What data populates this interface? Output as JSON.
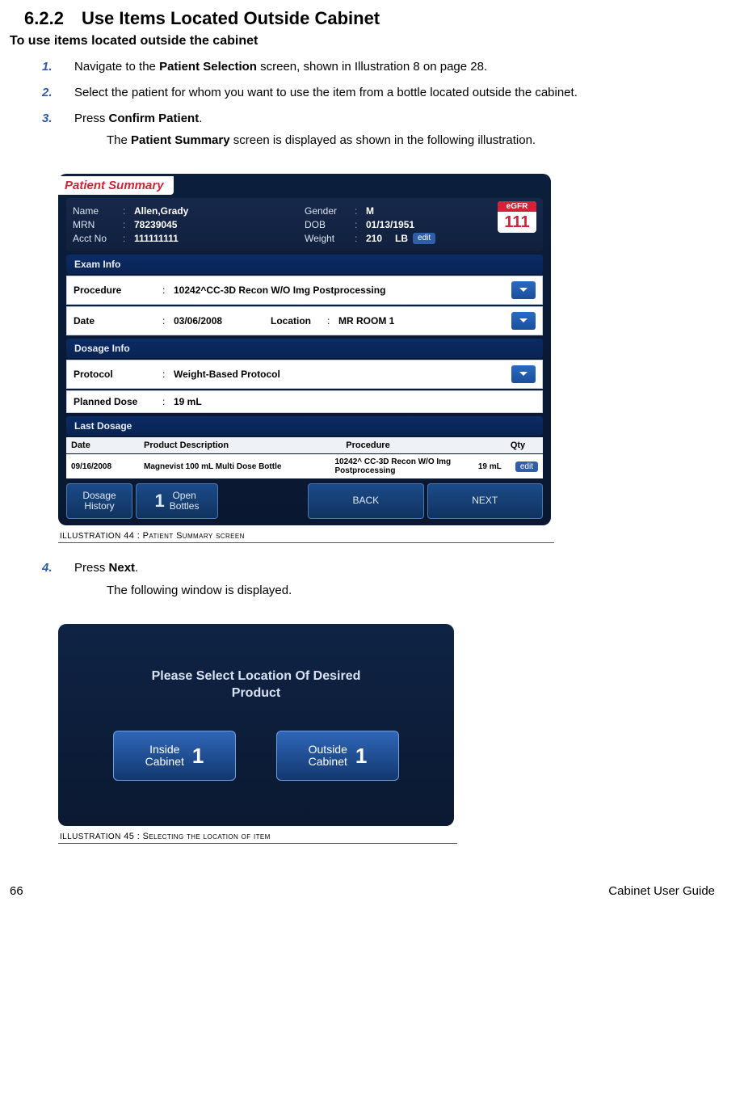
{
  "heading": {
    "number": "6.2.2",
    "title": "Use Items Located Outside Cabinet"
  },
  "subheading": "To use items located outside the cabinet",
  "steps": {
    "s1": {
      "num": "1.",
      "pre": "Navigate to the ",
      "bold": "Patient Selection",
      "post": " screen, shown in Illustration 8 on page 28."
    },
    "s2": {
      "num": "2.",
      "text": "Select the patient for whom you want to use the item from a bottle located outside the cabinet."
    },
    "s3": {
      "num": "3.",
      "pre": "Press ",
      "bold": "Confirm Patient",
      "post": ".",
      "cont_pre": "The ",
      "cont_bold": "Patient Summary",
      "cont_post": " screen is displayed as shown in the following illustration."
    },
    "s4": {
      "num": "4.",
      "pre": "Press ",
      "bold": "Next",
      "post": ".",
      "cont": "The following window is displayed."
    }
  },
  "patient_summary": {
    "title": "Patient Summary",
    "name_lbl": "Name",
    "name_val": "Allen,Grady",
    "mrn_lbl": "MRN",
    "mrn_val": "78239045",
    "acct_lbl": "Acct No",
    "acct_val": "111111111",
    "gender_lbl": "Gender",
    "gender_val": "M",
    "dob_lbl": "DOB",
    "dob_val": "01/13/1951",
    "weight_lbl": "Weight",
    "weight_val": "210",
    "weight_unit": "LB",
    "edit": "edit",
    "egfr_lbl": "eGFR",
    "egfr_val": "111",
    "exam_band": "Exam Info",
    "procedure_lbl": "Procedure",
    "procedure_val": "10242^CC-3D Recon W/O Img Postprocessing",
    "date_lbl": "Date",
    "date_val": "03/06/2008",
    "location_lbl": "Location",
    "location_val": "MR ROOM 1",
    "dosage_band": "Dosage Info",
    "protocol_lbl": "Protocol",
    "protocol_val": "Weight-Based Protocol",
    "planned_lbl": "Planned Dose",
    "planned_val": "19 mL",
    "last_band": "Last Dosage",
    "last_hdr": {
      "date": "Date",
      "prod": "Product Description",
      "proc": "Procedure",
      "qty": "Qty"
    },
    "last_row": {
      "date": "09/16/2008",
      "prod": "Magnevist 100 mL Multi Dose Bottle",
      "proc": "10242^ CC-3D Recon W/O Img Postprocessing",
      "qty": "19 mL"
    },
    "btns": {
      "dosage_history": "Dosage\nHistory",
      "open_num": "1",
      "open_lbl": "Open\nBottles",
      "back": "BACK",
      "next": "NEXT"
    }
  },
  "caption1": {
    "pre": "Illustration",
    "num": " 44 : P",
    "rest": "atient Summary screen"
  },
  "location_dialog": {
    "prompt1": "Please Select Location Of Desired",
    "prompt2": "Product",
    "inside": "Inside\nCabinet",
    "outside": "Outside\nCabinet",
    "count": "1"
  },
  "caption2": {
    "pre": "Illustration",
    "num": " 45 : S",
    "rest": "electing the location of item"
  },
  "footer": {
    "page": "66",
    "doc": "Cabinet User Guide"
  }
}
